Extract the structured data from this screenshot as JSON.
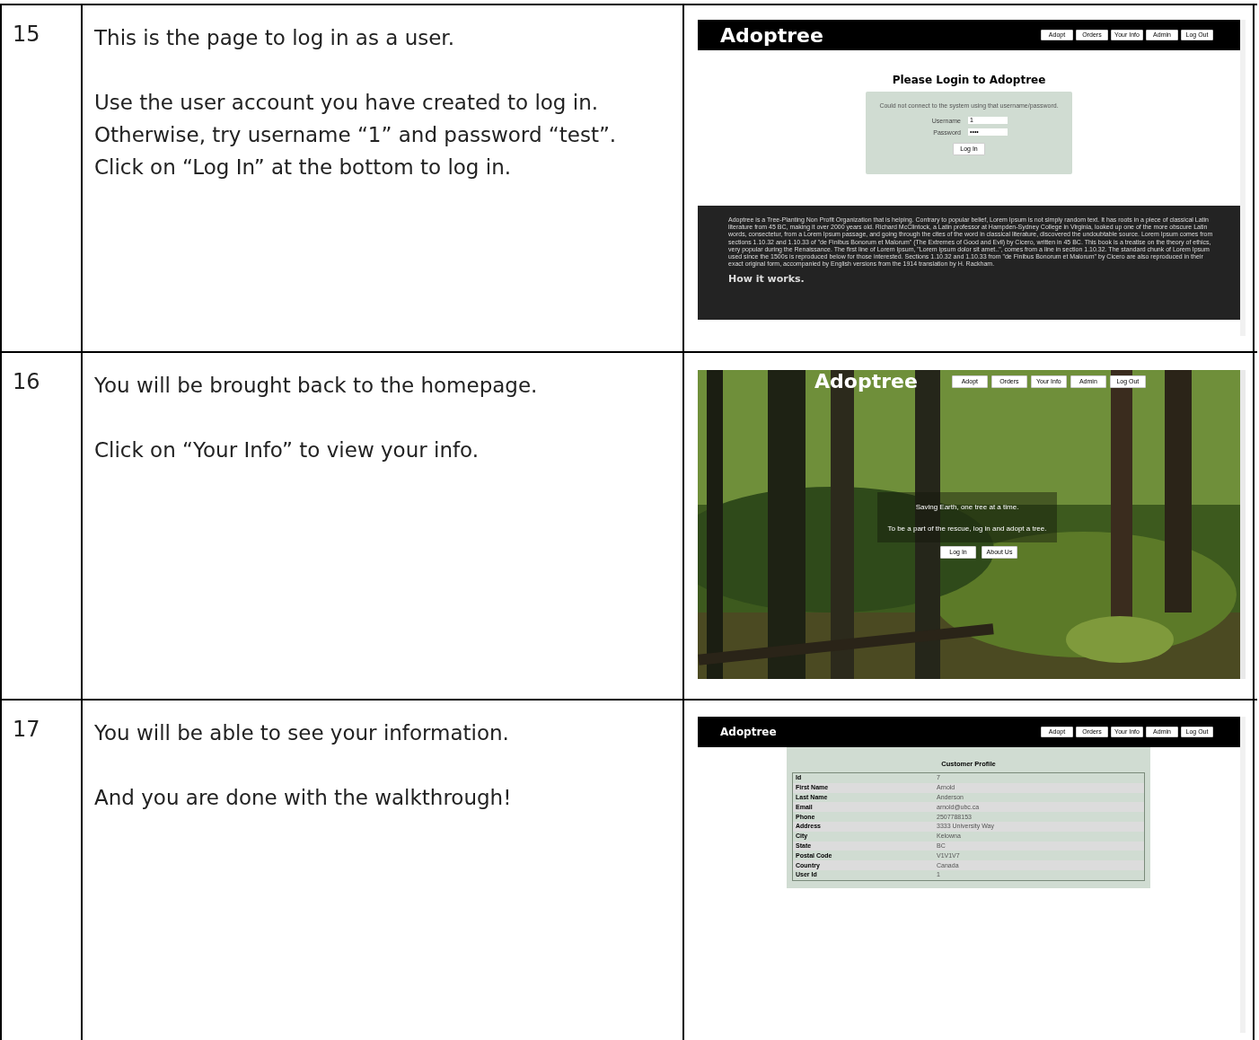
{
  "steps": [
    {
      "number": "15",
      "paragraphs": [
        [
          "This is the page to log in as a user."
        ],
        [
          "Use the user account you have created to log in.",
          "Otherwise, try username “1” and password “test”.",
          "Click on “Log In” at the bottom to log in."
        ]
      ],
      "screen": {
        "kind": "login",
        "logo": "Adoptree",
        "nav": [
          "Adopt",
          "Orders",
          "Your Info",
          "Admin",
          "Log Out"
        ],
        "heading": "Please Login to Adoptree",
        "error": "Could not connect to the system using that username/password.",
        "fields": [
          {
            "label": "Username",
            "value": "1"
          },
          {
            "label": "Password",
            "value": "••••"
          }
        ],
        "button": "Log In",
        "footer_text": "Adoptree is a Tree-Planting Non Profit Organization that is helping. Contrary to popular belief, Lorem Ipsum is not simply random text. It has roots in a piece of classical Latin literature from 45 BC, making it over 2000 years old. Richard McClintock, a Latin professor at Hampden-Sydney College in Virginia, looked up one of the more obscure Latin words, consectetur, from a Lorem Ipsum passage, and going through the cites of the word in classical literature, discovered the undoubtable source. Lorem Ipsum comes from sections 1.10.32 and 1.10.33 of \"de Finibus Bonorum et Malorum\" (The Extremes of Good and Evil) by Cicero, written in 45 BC. This book is a treatise on the theory of ethics, very popular during the Renaissance. The first line of Lorem Ipsum, \"Lorem ipsum dolor sit amet..\", comes from a line in section 1.10.32. The standard chunk of Lorem Ipsum used since the 1500s is reproduced below for those interested. Sections 1.10.32 and 1.10.33 from \"de Finibus Bonorum et Malorum\" by Cicero are also reproduced in their exact original form, accompanied by English versions from the 1914 translation by H. Rackham.",
        "footer_heading": "How it works."
      }
    },
    {
      "number": "16",
      "paragraphs": [
        [
          "You will be brought back to the homepage."
        ],
        [
          "Click on “Your Info” to view your info."
        ]
      ],
      "screen": {
        "kind": "home",
        "logo": "Adoptree",
        "nav": [
          "Adopt",
          "Orders",
          "Your Info",
          "Admin",
          "Log Out"
        ],
        "taglines": [
          "Saving Earth, one tree at a time.",
          "To be a part of the rescue, log in and adopt a tree."
        ],
        "buttons": [
          "Log In",
          "About Us"
        ]
      }
    },
    {
      "number": "17",
      "paragraphs": [
        [
          "You will be able to see your information."
        ],
        [
          "And you are done with the walkthrough!"
        ]
      ],
      "screen": {
        "kind": "profile",
        "logo": "Adoptree",
        "nav": [
          "Adopt",
          "Orders",
          "Your Info",
          "Admin",
          "Log Out"
        ],
        "heading": "Customer Profile",
        "rows": [
          {
            "label": "Id",
            "value": "7"
          },
          {
            "label": "First Name",
            "value": "Arnold"
          },
          {
            "label": "Last Name",
            "value": "Anderson"
          },
          {
            "label": "Email",
            "value": "arnold@ubc.ca"
          },
          {
            "label": "Phone",
            "value": "2507788153"
          },
          {
            "label": "Address",
            "value": "3333 University Way"
          },
          {
            "label": "City",
            "value": "Kelowna"
          },
          {
            "label": "State",
            "value": "BC"
          },
          {
            "label": "Postal Code",
            "value": "V1V1V7"
          },
          {
            "label": "Country",
            "value": "Canada"
          },
          {
            "label": "User Id",
            "value": "1"
          }
        ]
      }
    }
  ]
}
